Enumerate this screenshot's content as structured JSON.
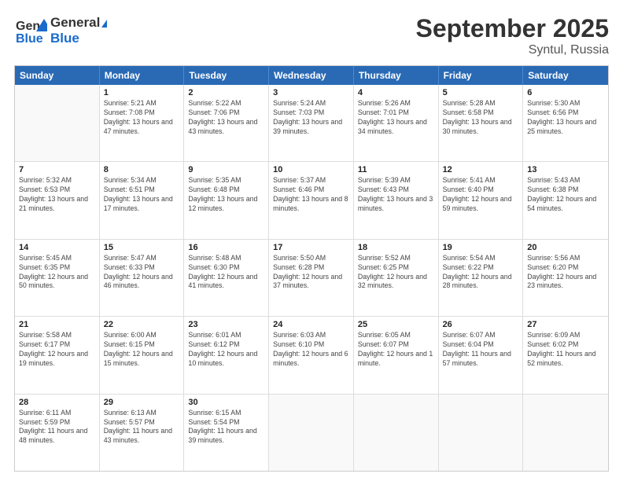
{
  "header": {
    "logo_general": "General",
    "logo_blue": "Blue",
    "month_title": "September 2025",
    "subtitle": "Syntul, Russia"
  },
  "calendar": {
    "weekdays": [
      "Sunday",
      "Monday",
      "Tuesday",
      "Wednesday",
      "Thursday",
      "Friday",
      "Saturday"
    ],
    "weeks": [
      [
        {
          "day": "",
          "sunrise": "",
          "sunset": "",
          "daylight": ""
        },
        {
          "day": "1",
          "sunrise": "Sunrise: 5:21 AM",
          "sunset": "Sunset: 7:08 PM",
          "daylight": "Daylight: 13 hours and 47 minutes."
        },
        {
          "day": "2",
          "sunrise": "Sunrise: 5:22 AM",
          "sunset": "Sunset: 7:06 PM",
          "daylight": "Daylight: 13 hours and 43 minutes."
        },
        {
          "day": "3",
          "sunrise": "Sunrise: 5:24 AM",
          "sunset": "Sunset: 7:03 PM",
          "daylight": "Daylight: 13 hours and 39 minutes."
        },
        {
          "day": "4",
          "sunrise": "Sunrise: 5:26 AM",
          "sunset": "Sunset: 7:01 PM",
          "daylight": "Daylight: 13 hours and 34 minutes."
        },
        {
          "day": "5",
          "sunrise": "Sunrise: 5:28 AM",
          "sunset": "Sunset: 6:58 PM",
          "daylight": "Daylight: 13 hours and 30 minutes."
        },
        {
          "day": "6",
          "sunrise": "Sunrise: 5:30 AM",
          "sunset": "Sunset: 6:56 PM",
          "daylight": "Daylight: 13 hours and 25 minutes."
        }
      ],
      [
        {
          "day": "7",
          "sunrise": "Sunrise: 5:32 AM",
          "sunset": "Sunset: 6:53 PM",
          "daylight": "Daylight: 13 hours and 21 minutes."
        },
        {
          "day": "8",
          "sunrise": "Sunrise: 5:34 AM",
          "sunset": "Sunset: 6:51 PM",
          "daylight": "Daylight: 13 hours and 17 minutes."
        },
        {
          "day": "9",
          "sunrise": "Sunrise: 5:35 AM",
          "sunset": "Sunset: 6:48 PM",
          "daylight": "Daylight: 13 hours and 12 minutes."
        },
        {
          "day": "10",
          "sunrise": "Sunrise: 5:37 AM",
          "sunset": "Sunset: 6:46 PM",
          "daylight": "Daylight: 13 hours and 8 minutes."
        },
        {
          "day": "11",
          "sunrise": "Sunrise: 5:39 AM",
          "sunset": "Sunset: 6:43 PM",
          "daylight": "Daylight: 13 hours and 3 minutes."
        },
        {
          "day": "12",
          "sunrise": "Sunrise: 5:41 AM",
          "sunset": "Sunset: 6:40 PM",
          "daylight": "Daylight: 12 hours and 59 minutes."
        },
        {
          "day": "13",
          "sunrise": "Sunrise: 5:43 AM",
          "sunset": "Sunset: 6:38 PM",
          "daylight": "Daylight: 12 hours and 54 minutes."
        }
      ],
      [
        {
          "day": "14",
          "sunrise": "Sunrise: 5:45 AM",
          "sunset": "Sunset: 6:35 PM",
          "daylight": "Daylight: 12 hours and 50 minutes."
        },
        {
          "day": "15",
          "sunrise": "Sunrise: 5:47 AM",
          "sunset": "Sunset: 6:33 PM",
          "daylight": "Daylight: 12 hours and 46 minutes."
        },
        {
          "day": "16",
          "sunrise": "Sunrise: 5:48 AM",
          "sunset": "Sunset: 6:30 PM",
          "daylight": "Daylight: 12 hours and 41 minutes."
        },
        {
          "day": "17",
          "sunrise": "Sunrise: 5:50 AM",
          "sunset": "Sunset: 6:28 PM",
          "daylight": "Daylight: 12 hours and 37 minutes."
        },
        {
          "day": "18",
          "sunrise": "Sunrise: 5:52 AM",
          "sunset": "Sunset: 6:25 PM",
          "daylight": "Daylight: 12 hours and 32 minutes."
        },
        {
          "day": "19",
          "sunrise": "Sunrise: 5:54 AM",
          "sunset": "Sunset: 6:22 PM",
          "daylight": "Daylight: 12 hours and 28 minutes."
        },
        {
          "day": "20",
          "sunrise": "Sunrise: 5:56 AM",
          "sunset": "Sunset: 6:20 PM",
          "daylight": "Daylight: 12 hours and 23 minutes."
        }
      ],
      [
        {
          "day": "21",
          "sunrise": "Sunrise: 5:58 AM",
          "sunset": "Sunset: 6:17 PM",
          "daylight": "Daylight: 12 hours and 19 minutes."
        },
        {
          "day": "22",
          "sunrise": "Sunrise: 6:00 AM",
          "sunset": "Sunset: 6:15 PM",
          "daylight": "Daylight: 12 hours and 15 minutes."
        },
        {
          "day": "23",
          "sunrise": "Sunrise: 6:01 AM",
          "sunset": "Sunset: 6:12 PM",
          "daylight": "Daylight: 12 hours and 10 minutes."
        },
        {
          "day": "24",
          "sunrise": "Sunrise: 6:03 AM",
          "sunset": "Sunset: 6:10 PM",
          "daylight": "Daylight: 12 hours and 6 minutes."
        },
        {
          "day": "25",
          "sunrise": "Sunrise: 6:05 AM",
          "sunset": "Sunset: 6:07 PM",
          "daylight": "Daylight: 12 hours and 1 minute."
        },
        {
          "day": "26",
          "sunrise": "Sunrise: 6:07 AM",
          "sunset": "Sunset: 6:04 PM",
          "daylight": "Daylight: 11 hours and 57 minutes."
        },
        {
          "day": "27",
          "sunrise": "Sunrise: 6:09 AM",
          "sunset": "Sunset: 6:02 PM",
          "daylight": "Daylight: 11 hours and 52 minutes."
        }
      ],
      [
        {
          "day": "28",
          "sunrise": "Sunrise: 6:11 AM",
          "sunset": "Sunset: 5:59 PM",
          "daylight": "Daylight: 11 hours and 48 minutes."
        },
        {
          "day": "29",
          "sunrise": "Sunrise: 6:13 AM",
          "sunset": "Sunset: 5:57 PM",
          "daylight": "Daylight: 11 hours and 43 minutes."
        },
        {
          "day": "30",
          "sunrise": "Sunrise: 6:15 AM",
          "sunset": "Sunset: 5:54 PM",
          "daylight": "Daylight: 11 hours and 39 minutes."
        },
        {
          "day": "",
          "sunrise": "",
          "sunset": "",
          "daylight": ""
        },
        {
          "day": "",
          "sunrise": "",
          "sunset": "",
          "daylight": ""
        },
        {
          "day": "",
          "sunrise": "",
          "sunset": "",
          "daylight": ""
        },
        {
          "day": "",
          "sunrise": "",
          "sunset": "",
          "daylight": ""
        }
      ]
    ]
  }
}
